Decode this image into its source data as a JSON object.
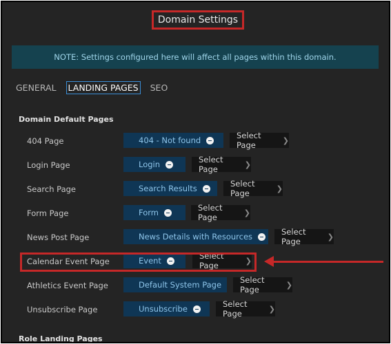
{
  "header": {
    "title": "Domain Settings"
  },
  "note": "NOTE: Settings configured here will affect all pages within this domain.",
  "tabs": [
    {
      "label": "GENERAL"
    },
    {
      "label": "LANDING PAGES",
      "active": true
    },
    {
      "label": "SEO"
    }
  ],
  "section": {
    "title": "Domain Default Pages"
  },
  "rows": [
    {
      "label": "404 Page",
      "value": "404 - Not found",
      "action": "Select Page"
    },
    {
      "label": "Login Page",
      "value": "Login",
      "action": "Select Page"
    },
    {
      "label": "Search Page",
      "value": "Search Results",
      "action": "Select Page"
    },
    {
      "label": "Form Page",
      "value": "Form",
      "action": "Select Page"
    },
    {
      "label": "News Post Page",
      "value": "News Details with Resources",
      "action": "Select Page"
    },
    {
      "label": "Calendar Event Page",
      "value": "Event",
      "action": "Select Page"
    },
    {
      "label": "Athletics Event Page",
      "value": "Default System Page",
      "action": "Select Page"
    },
    {
      "label": "Unsubscribe Page",
      "value": "Unsubscribe",
      "action": "Select Page"
    }
  ],
  "section2": {
    "title": "Role Landing Pages"
  },
  "colors": {
    "background": "#242424",
    "note_bg": "#15424f",
    "note_text": "#9fd5ea",
    "chip_bg": "#0f3655",
    "chip_text": "#8ec5ea",
    "highlight": "#c62828",
    "active_tab_border": "#3b8fd8"
  }
}
